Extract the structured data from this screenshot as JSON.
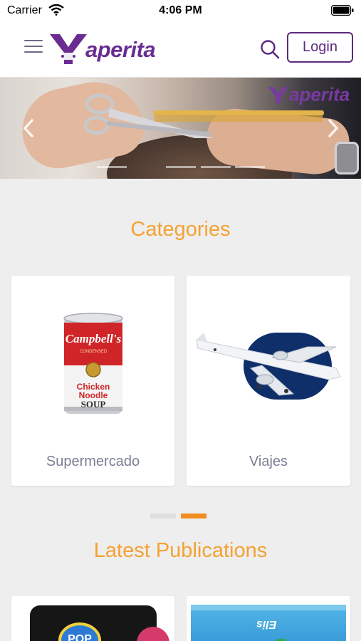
{
  "status_bar": {
    "carrier": "Carrier",
    "time": "4:06 PM"
  },
  "header": {
    "logo_text": "aperita",
    "login_label": "Login"
  },
  "banner": {
    "watermark_text": "aperita",
    "slide_count": 4,
    "active_slide": 0
  },
  "categories": {
    "title": "Categories",
    "items": [
      {
        "label": "Supermercado",
        "image": "soup-can"
      },
      {
        "label": "Viajes",
        "image": "airplane"
      }
    ],
    "page_count": 2,
    "active_page": 1
  },
  "publications": {
    "title": "Latest Publications",
    "items": [
      {
        "image": "candy-package",
        "text": "POP"
      },
      {
        "image": "product-box",
        "text": "Elis"
      }
    ]
  },
  "colors": {
    "brand_purple": "#6a2c91",
    "accent_orange": "#f4a233",
    "pager_active": "#f08d1c"
  },
  "icons": [
    "wifi-icon",
    "battery-icon",
    "menu-icon",
    "search-icon",
    "chevron-left-icon",
    "chevron-right-icon"
  ]
}
